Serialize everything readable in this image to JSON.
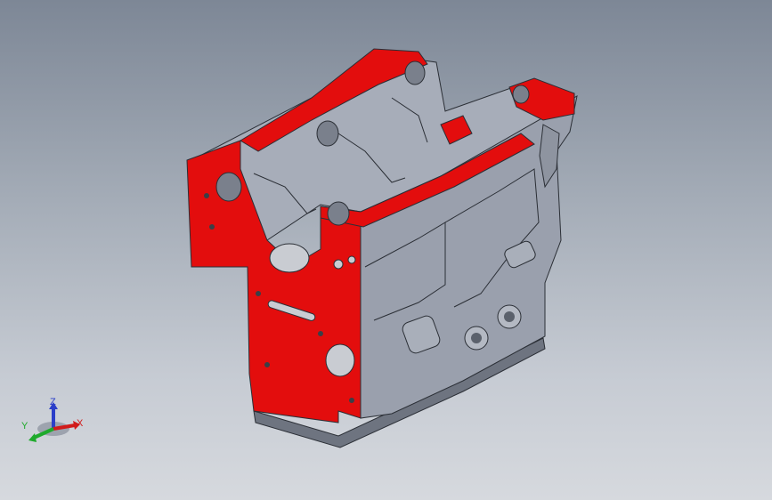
{
  "viewport": {
    "background_top": "#7d8796",
    "background_bottom": "#d6d9de"
  },
  "model": {
    "name": "engine-block",
    "face_color": "#e30d0d",
    "body_color": "#9aa0ad",
    "edge_color": "#2b2f36"
  },
  "triad": {
    "z_label": "Z",
    "x_label": "X",
    "y_label": "Y",
    "z_color": "#2c3fc9",
    "x_color": "#d11b1b",
    "y_color": "#1faa2c"
  }
}
